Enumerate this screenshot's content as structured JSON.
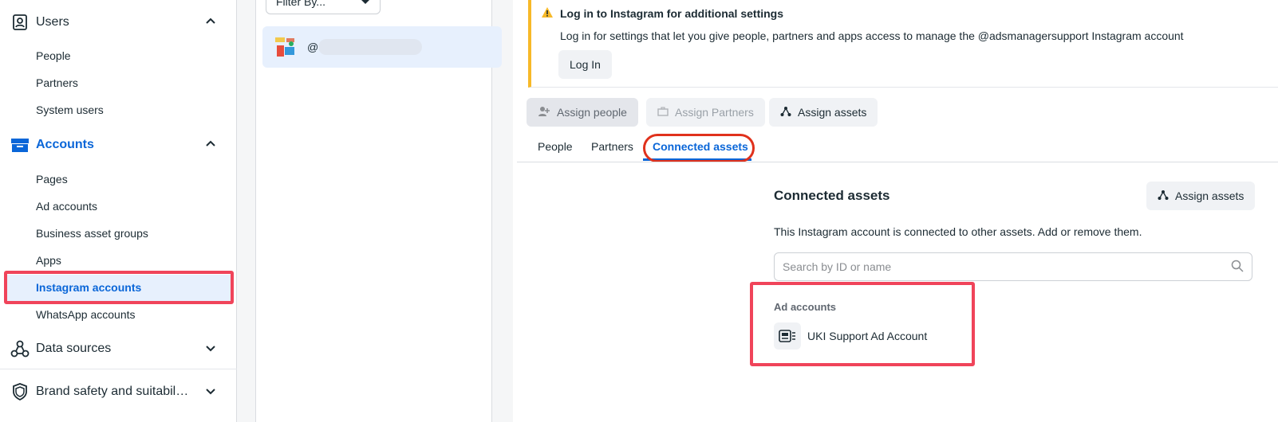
{
  "sidebar": {
    "users": {
      "label": "Users",
      "items": [
        "People",
        "Partners",
        "System users"
      ]
    },
    "accounts": {
      "label": "Accounts",
      "items": [
        "Pages",
        "Ad accounts",
        "Business asset groups",
        "Apps",
        "Instagram accounts",
        "WhatsApp accounts"
      ],
      "active": "Instagram accounts"
    },
    "data_sources": {
      "label": "Data sources"
    },
    "brand_safety": {
      "label": "Brand safety and suitabil…"
    }
  },
  "list": {
    "filter_label": "Filter By...",
    "account_handle": "@"
  },
  "banner": {
    "title": "Log in to Instagram for additional settings",
    "text": "Log in for settings that let you give people, partners and apps access to manage the @adsmanagersupport Instagram account",
    "login_label": "Log In"
  },
  "actions": {
    "assign_people": "Assign people",
    "assign_partners": "Assign Partners",
    "assign_assets": "Assign assets"
  },
  "tabs": [
    "People",
    "Partners",
    "Connected assets"
  ],
  "active_tab": "Connected assets",
  "connected": {
    "title": "Connected assets",
    "assign_label": "Assign assets",
    "description": "This Instagram account is connected to other assets. Add or remove them.",
    "search_placeholder": "Search by ID or name",
    "group_label": "Ad accounts",
    "item": "UKI Support Ad Account"
  },
  "colors": {
    "accent": "#0a66d8",
    "highlight": "#f0445a",
    "warning": "#f7b928"
  }
}
